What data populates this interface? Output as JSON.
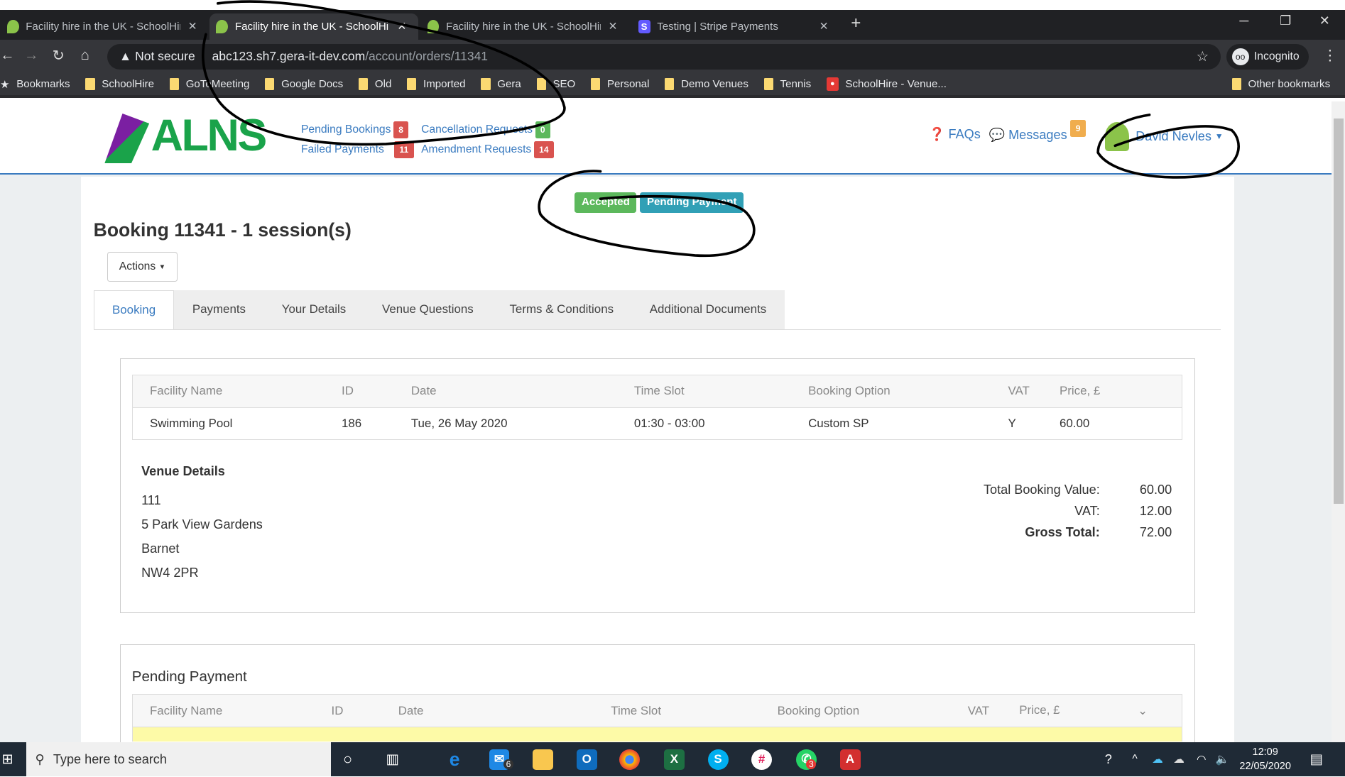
{
  "browser": {
    "tabs": [
      {
        "title": "Facility hire in the UK - SchoolHire",
        "active": false
      },
      {
        "title": "Facility hire in the UK - SchoolHire",
        "active": true
      },
      {
        "title": "Facility hire in the UK - SchoolHire",
        "active": false
      },
      {
        "title": "Testing | Stripe Payments",
        "active": false
      }
    ],
    "security": "Not secure",
    "url_host": "abc123.sh7.gera-it-dev.com",
    "url_path": "/account/orders/11341",
    "profile": "Incognito",
    "bookmarks": [
      "Bookmarks",
      "SchoolHire",
      "GoToMeeting",
      "Google Docs",
      "Old",
      "Imported",
      "Gera",
      "SEO",
      "Personal",
      "Demo Venues",
      "Tennis",
      "SchoolHire - Venue..."
    ],
    "other_bookmarks": "Other bookmarks"
  },
  "header": {
    "logo": "ALNS",
    "links": [
      {
        "label": "Pending Bookings",
        "count": "8",
        "color": "#d9534f"
      },
      {
        "label": "Cancellation Requests",
        "count": "0",
        "color": "#5cb85c"
      },
      {
        "label": "Failed Payments",
        "count": "11",
        "color": "#d9534f"
      },
      {
        "label": "Amendment Requests",
        "count": "14",
        "color": "#d9534f"
      }
    ],
    "faqs": "FAQs",
    "messages": "Messages",
    "messages_count": "9",
    "user": "David Nevles"
  },
  "booking": {
    "statuses": [
      "Accepted",
      "Pending Payment"
    ],
    "title": "Booking 11341 - 1 session(s)",
    "actions": "Actions",
    "tabs": [
      "Booking",
      "Payments",
      "Your Details",
      "Venue Questions",
      "Terms & Conditions",
      "Additional Documents"
    ],
    "columns": [
      "Facility Name",
      "ID",
      "Date",
      "Time Slot",
      "Booking Option",
      "VAT",
      "Price, £"
    ],
    "rows": [
      [
        "Swimming Pool",
        "186",
        "Tue, 26 May 2020",
        "01:30 - 03:00",
        "Custom SP",
        "Y",
        "60.00"
      ]
    ],
    "venue_heading": "Venue Details",
    "venue_lines": [
      "111",
      "5 Park View Gardens",
      "Barnet",
      "NW4 2PR"
    ],
    "totals": [
      {
        "label": "Total Booking Value:",
        "value": "60.00"
      },
      {
        "label": "VAT:",
        "value": "12.00"
      },
      {
        "label": "Gross Total:",
        "value": "72.00"
      }
    ],
    "pending_heading": "Pending Payment"
  },
  "taskbar": {
    "search": "Type here to search",
    "time": "12:09",
    "date": "22/05/2020",
    "mail_badge": "6",
    "whatsapp_badge": "3"
  }
}
